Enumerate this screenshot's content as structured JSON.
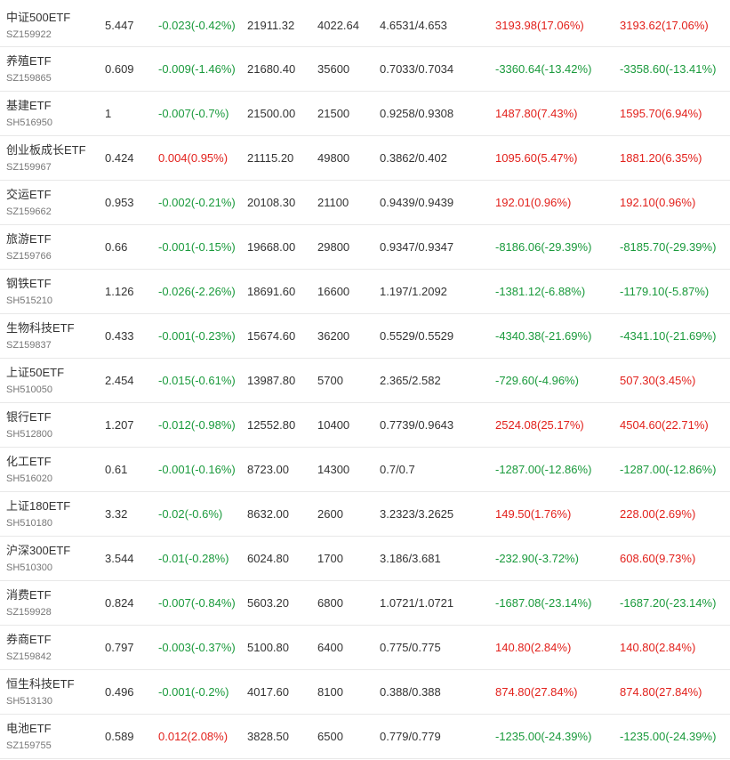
{
  "colors": {
    "up": "#e2211c",
    "down": "#1a9a3c"
  },
  "rows": [
    {
      "name": "中证500ETF",
      "code": "SZ159922",
      "price": "5.447",
      "change": "-0.023(-0.42%)",
      "change_dir": "down",
      "amount": "21911.32",
      "volume": "4022.64",
      "range": "4.6531/4.653",
      "profit1": "3193.98(17.06%)",
      "profit1_dir": "up",
      "profit2": "3193.62(17.06%)",
      "profit2_dir": "up"
    },
    {
      "name": "养殖ETF",
      "code": "SZ159865",
      "price": "0.609",
      "change": "-0.009(-1.46%)",
      "change_dir": "down",
      "amount": "21680.40",
      "volume": "35600",
      "range": "0.7033/0.7034",
      "profit1": "-3360.64(-13.42%)",
      "profit1_dir": "down",
      "profit2": "-3358.60(-13.41%)",
      "profit2_dir": "down"
    },
    {
      "name": "基建ETF",
      "code": "SH516950",
      "price": "1",
      "change": "-0.007(-0.7%)",
      "change_dir": "down",
      "amount": "21500.00",
      "volume": "21500",
      "range": "0.9258/0.9308",
      "profit1": "1487.80(7.43%)",
      "profit1_dir": "up",
      "profit2": "1595.70(6.94%)",
      "profit2_dir": "up"
    },
    {
      "name": "创业板成长ETF",
      "code": "SZ159967",
      "price": "0.424",
      "change": "0.004(0.95%)",
      "change_dir": "up",
      "amount": "21115.20",
      "volume": "49800",
      "range": "0.3862/0.402",
      "profit1": "1095.60(5.47%)",
      "profit1_dir": "up",
      "profit2": "1881.20(6.35%)",
      "profit2_dir": "up"
    },
    {
      "name": "交运ETF",
      "code": "SZ159662",
      "price": "0.953",
      "change": "-0.002(-0.21%)",
      "change_dir": "down",
      "amount": "20108.30",
      "volume": "21100",
      "range": "0.9439/0.9439",
      "profit1": "192.01(0.96%)",
      "profit1_dir": "up",
      "profit2": "192.10(0.96%)",
      "profit2_dir": "up"
    },
    {
      "name": "旅游ETF",
      "code": "SZ159766",
      "price": "0.66",
      "change": "-0.001(-0.15%)",
      "change_dir": "down",
      "amount": "19668.00",
      "volume": "29800",
      "range": "0.9347/0.9347",
      "profit1": "-8186.06(-29.39%)",
      "profit1_dir": "down",
      "profit2": "-8185.70(-29.39%)",
      "profit2_dir": "down"
    },
    {
      "name": "钢铁ETF",
      "code": "SH515210",
      "price": "1.126",
      "change": "-0.026(-2.26%)",
      "change_dir": "down",
      "amount": "18691.60",
      "volume": "16600",
      "range": "1.197/1.2092",
      "profit1": "-1381.12(-6.88%)",
      "profit1_dir": "down",
      "profit2": "-1179.10(-5.87%)",
      "profit2_dir": "down"
    },
    {
      "name": "生物科技ETF",
      "code": "SZ159837",
      "price": "0.433",
      "change": "-0.001(-0.23%)",
      "change_dir": "down",
      "amount": "15674.60",
      "volume": "36200",
      "range": "0.5529/0.5529",
      "profit1": "-4340.38(-21.69%)",
      "profit1_dir": "down",
      "profit2": "-4341.10(-21.69%)",
      "profit2_dir": "down"
    },
    {
      "name": "上证50ETF",
      "code": "SH510050",
      "price": "2.454",
      "change": "-0.015(-0.61%)",
      "change_dir": "down",
      "amount": "13987.80",
      "volume": "5700",
      "range": "2.365/2.582",
      "profit1": "-729.60(-4.96%)",
      "profit1_dir": "down",
      "profit2": "507.30(3.45%)",
      "profit2_dir": "up"
    },
    {
      "name": "银行ETF",
      "code": "SH512800",
      "price": "1.207",
      "change": "-0.012(-0.98%)",
      "change_dir": "down",
      "amount": "12552.80",
      "volume": "10400",
      "range": "0.7739/0.9643",
      "profit1": "2524.08(25.17%)",
      "profit1_dir": "up",
      "profit2": "4504.60(22.71%)",
      "profit2_dir": "up"
    },
    {
      "name": "化工ETF",
      "code": "SH516020",
      "price": "0.61",
      "change": "-0.001(-0.16%)",
      "change_dir": "down",
      "amount": "8723.00",
      "volume": "14300",
      "range": "0.7/0.7",
      "profit1": "-1287.00(-12.86%)",
      "profit1_dir": "down",
      "profit2": "-1287.00(-12.86%)",
      "profit2_dir": "down"
    },
    {
      "name": "上证180ETF",
      "code": "SH510180",
      "price": "3.32",
      "change": "-0.02(-0.6%)",
      "change_dir": "down",
      "amount": "8632.00",
      "volume": "2600",
      "range": "3.2323/3.2625",
      "profit1": "149.50(1.76%)",
      "profit1_dir": "up",
      "profit2": "228.00(2.69%)",
      "profit2_dir": "up"
    },
    {
      "name": "沪深300ETF",
      "code": "SH510300",
      "price": "3.544",
      "change": "-0.01(-0.28%)",
      "change_dir": "down",
      "amount": "6024.80",
      "volume": "1700",
      "range": "3.186/3.681",
      "profit1": "-232.90(-3.72%)",
      "profit1_dir": "down",
      "profit2": "608.60(9.73%)",
      "profit2_dir": "up"
    },
    {
      "name": "消费ETF",
      "code": "SZ159928",
      "price": "0.824",
      "change": "-0.007(-0.84%)",
      "change_dir": "down",
      "amount": "5603.20",
      "volume": "6800",
      "range": "1.0721/1.0721",
      "profit1": "-1687.08(-23.14%)",
      "profit1_dir": "down",
      "profit2": "-1687.20(-23.14%)",
      "profit2_dir": "down"
    },
    {
      "name": "券商ETF",
      "code": "SZ159842",
      "price": "0.797",
      "change": "-0.003(-0.37%)",
      "change_dir": "down",
      "amount": "5100.80",
      "volume": "6400",
      "range": "0.775/0.775",
      "profit1": "140.80(2.84%)",
      "profit1_dir": "up",
      "profit2": "140.80(2.84%)",
      "profit2_dir": "up"
    },
    {
      "name": "恒生科技ETF",
      "code": "SH513130",
      "price": "0.496",
      "change": "-0.001(-0.2%)",
      "change_dir": "down",
      "amount": "4017.60",
      "volume": "8100",
      "range": "0.388/0.388",
      "profit1": "874.80(27.84%)",
      "profit1_dir": "up",
      "profit2": "874.80(27.84%)",
      "profit2_dir": "up"
    },
    {
      "name": "电池ETF",
      "code": "SZ159755",
      "price": "0.589",
      "change": "0.012(2.08%)",
      "change_dir": "up",
      "amount": "3828.50",
      "volume": "6500",
      "range": "0.779/0.779",
      "profit1": "-1235.00(-24.39%)",
      "profit1_dir": "down",
      "profit2": "-1235.00(-24.39%)",
      "profit2_dir": "down"
    }
  ]
}
